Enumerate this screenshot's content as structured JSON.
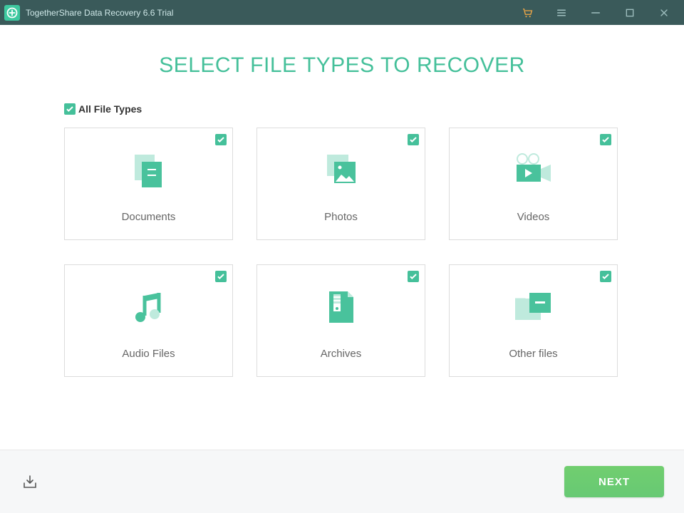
{
  "titlebar": {
    "app_title": "TogetherShare Data Recovery 6.6 Trial"
  },
  "page": {
    "heading": "SELECT FILE TYPES TO RECOVER",
    "all_label": "All File Types",
    "all_checked": true
  },
  "cards": [
    {
      "name": "documents",
      "label": "Documents",
      "checked": true
    },
    {
      "name": "photos",
      "label": "Photos",
      "checked": true
    },
    {
      "name": "videos",
      "label": "Videos",
      "checked": true
    },
    {
      "name": "audio",
      "label": "Audio Files",
      "checked": true
    },
    {
      "name": "archives",
      "label": "Archives",
      "checked": true
    },
    {
      "name": "other",
      "label": "Other files",
      "checked": true
    }
  ],
  "footer": {
    "next_label": "NEXT"
  },
  "colors": {
    "accent": "#45c09a",
    "button_green": "#6ccb71",
    "titlebar_bg": "#3a5a5a"
  }
}
